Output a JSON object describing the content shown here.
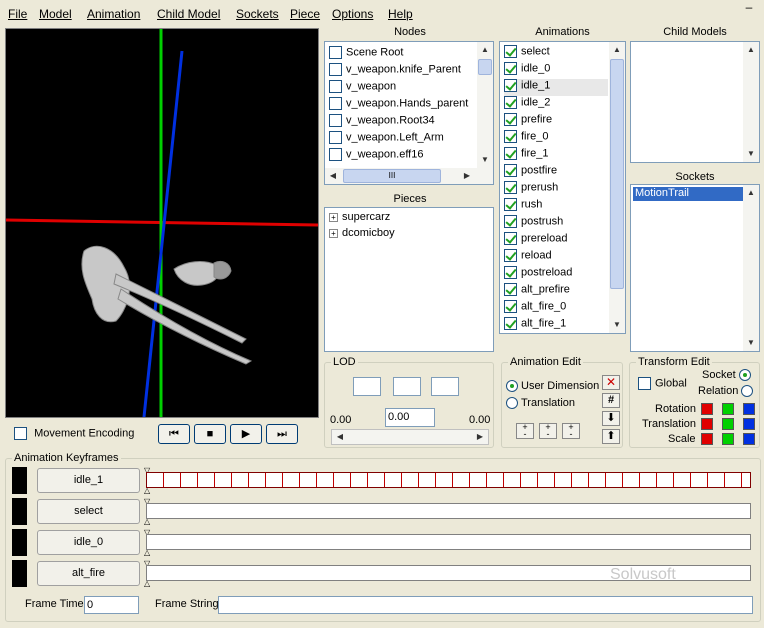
{
  "menu": [
    "File",
    "Model",
    "Animation",
    "Child Model",
    "Sockets",
    "Piece",
    "Options",
    "Help"
  ],
  "window_button": "–",
  "nodes": {
    "header": "Nodes",
    "items": [
      "Scene Root",
      "v_weapon.knife_Parent",
      "v_weapon",
      "v_weapon.Hands_parent",
      "v_weapon.Root34",
      "v_weapon.Left_Arm",
      "v_weapon.eff16"
    ],
    "hscroll_glyph": "III"
  },
  "pieces": {
    "header": "Pieces",
    "items": [
      "supercarz",
      "dcomicboy"
    ]
  },
  "animations": {
    "header": "Animations",
    "items": [
      "select",
      "idle_0",
      "idle_1",
      "idle_2",
      "prefire",
      "fire_0",
      "fire_1",
      "postfire",
      "prerush",
      "rush",
      "postrush",
      "prereload",
      "reload",
      "postreload",
      "alt_prefire",
      "alt_fire_0",
      "alt_fire_1"
    ],
    "selected": "idle_1"
  },
  "child_models": {
    "header": "Child Models"
  },
  "sockets": {
    "header": "Sockets",
    "items": [
      "MotionTrail"
    ]
  },
  "viewport": {
    "movement_encoding_label": "Movement Encoding"
  },
  "playback": [
    "⏮",
    "■",
    "▶",
    "⏭"
  ],
  "lod": {
    "title": "LOD",
    "min_label": "0.00",
    "value": "0.00",
    "max_label": "0.00"
  },
  "animation_edit": {
    "title": "Animation Edit",
    "user_dimension": "User Dimension",
    "translation": "Translation",
    "pm_label": "+\n-"
  },
  "transform_edit": {
    "title": "Transform Edit",
    "global": "Global",
    "socket": "Socket",
    "relation": "Relation",
    "rows": [
      "Rotation",
      "Translation",
      "Scale"
    ]
  },
  "keyframes": {
    "title": "Animation Keyframes",
    "tracks": [
      "idle_1",
      "select",
      "idle_0",
      "alt_fire"
    ],
    "frame_time_label": "Frame Time:",
    "frame_time_value": "0",
    "frame_string_label": "Frame String:",
    "frame_string_value": ""
  },
  "watermark": "Solvusoft",
  "colors": {
    "red": "#e00000",
    "green": "#00d000",
    "blue": "#0030e0",
    "selection": "#316ac5"
  }
}
